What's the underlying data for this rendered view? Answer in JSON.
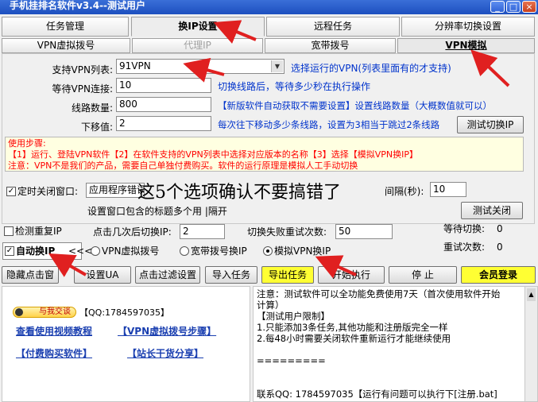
{
  "window": {
    "title": "手机挂排名软件v3.4--测试用户",
    "min": "_",
    "max": "□",
    "close": "×"
  },
  "main_tabs": [
    {
      "label": "任务管理"
    },
    {
      "label": "换IP设置"
    },
    {
      "label": "远程任务"
    },
    {
      "label": "分辨率切换设置"
    }
  ],
  "sub_tabs": [
    {
      "label": "VPN虚拟拨号"
    },
    {
      "label": "代理IP"
    },
    {
      "label": "宽带拨号"
    },
    {
      "label": "VPN模拟"
    }
  ],
  "vpn": {
    "list_label": "支持VPN列表:",
    "list_value": "91VPN",
    "list_hint": "选择运行的VPN(列表里面有的才支持)",
    "wait_label": "等待VPN连接:",
    "wait_value": "10",
    "wait_hint": "切换线路后，等待多少秒在执行操作",
    "lines_label": "线路数量:",
    "lines_value": "800",
    "lines_hint": "【新版软件自动获取不需要设置】设置线路数量（大概数值就可以）",
    "step_label": "下移值:",
    "step_value": "2",
    "step_hint": "每次往下移动多少条线路，设置为3相当于跳过2条线路",
    "test_button": "测试切换IP"
  },
  "notice": {
    "line1": "使用步骤:",
    "line2": "【1】运行、登陆VPN软件【2】在软件支持的VPN列表中选择对应版本的名称【3】选择【模拟VPN换IP】",
    "line3": "注意：VPN不是我们的产品，需要自己单独付费购买。软件的运行原理是模拟人工手动切换"
  },
  "timer": {
    "checkbox_label": "定时关闭窗口:",
    "checked": true,
    "window_value": "应用程序错误",
    "interval_label": "间隔(秒):",
    "interval_value": "10",
    "hint": "设置窗口包含的标题多个用 |隔开",
    "test_close_button": "测试关闭"
  },
  "annotation_text": "这5个选项确认不要搞错了",
  "options": {
    "dup_ip_label": "检测重复IP",
    "dup_ip_checked": false,
    "clicks_label": "点击几次后切换IP:",
    "clicks_value": "2",
    "fail_label": "切换失败重试次数:",
    "fail_value": "50",
    "wait_switch_label": "等待切换:",
    "wait_switch_value": "0",
    "retry_label": "重试次数:",
    "retry_value": "0",
    "auto_label": "自动换IP",
    "auto_checked": true,
    "chevrons": "<<<",
    "radios": [
      {
        "label": "VPN虚拟拨号",
        "selected": false
      },
      {
        "label": "宽带拨号换IP",
        "selected": false
      },
      {
        "label": "模拟VPN换IP",
        "selected": true
      }
    ]
  },
  "toolbar": [
    {
      "label": "隐藏点击窗"
    },
    {
      "label": "设置UA"
    },
    {
      "label": "点击过滤设置"
    },
    {
      "label": "导入任务"
    },
    {
      "label": "导出任务"
    },
    {
      "label": "开始执行"
    },
    {
      "label": "停 止"
    },
    {
      "label": "会员登录"
    }
  ],
  "contact": {
    "qq_badge": "与我交谈",
    "qq_text": "【QQ:1784597035】",
    "links": [
      "查看使用视频教程",
      "【VPN虚拟拨号步骤】",
      "【付费购买软件】",
      "【站长干货分享】"
    ]
  },
  "notes": {
    "text": "注意：测试软件可以全功能免费使用7天（首次使用软件开始\n计算）\n【测试用户限制】\n1.只能添加3条任务,其他功能和注册版完全一样\n2.每48小时需要关闭软件重新运行才能继续使用\n\n=========\n\n\n联系QQ: 1784597035【运行有问题可以执行下[注册.bat]"
  },
  "colors": {
    "title_bar": "#2b5fcf",
    "notice_bg": "#ffffe1",
    "notice_text": "#ff0000",
    "hint_text": "#0033cc",
    "export_button": "#ffff33",
    "arrow": "#e02020"
  }
}
